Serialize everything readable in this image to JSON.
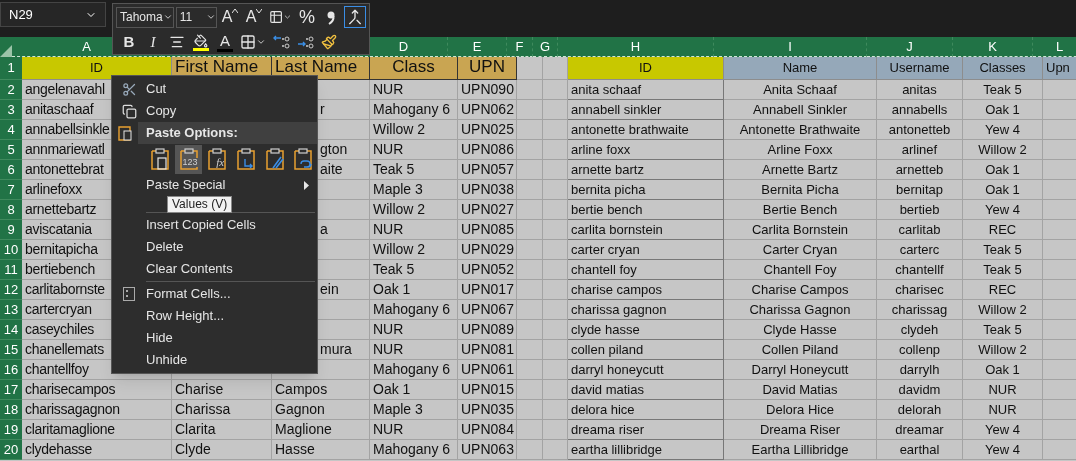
{
  "name_box": {
    "value": "N29"
  },
  "mini_toolbar": {
    "font_name": "Tahoma",
    "font_size": "11",
    "row_1": [
      {
        "kind": "grow-font",
        "glyph": "A"
      },
      {
        "kind": "shrink-font",
        "glyph": "A"
      },
      {
        "kind": "cell-styles"
      },
      {
        "kind": "percent",
        "glyph": "%"
      },
      {
        "kind": "comma"
      },
      {
        "kind": "merge"
      }
    ],
    "row_2": [
      {
        "kind": "bold",
        "glyph": "B"
      },
      {
        "kind": "italic",
        "glyph": "I"
      },
      {
        "kind": "center"
      },
      {
        "kind": "fill-color",
        "color": "#ffff00"
      },
      {
        "kind": "font-color",
        "glyph": "A",
        "color": "#000000"
      },
      {
        "kind": "borders"
      },
      {
        "kind": "inc-decimal"
      },
      {
        "kind": "dec-decimal"
      },
      {
        "kind": "painter"
      }
    ]
  },
  "columns": {
    "a": "A",
    "d": "D",
    "e": "E",
    "f": "F",
    "g": "G",
    "h": "H",
    "i": "I",
    "j": "J",
    "k": "K",
    "l": "L"
  },
  "header_row": {
    "number": "1",
    "cells": {
      "a": {
        "text": "ID",
        "color": "#c8c800"
      },
      "b": {
        "text": "First Name",
        "color": "#c9a552"
      },
      "c": {
        "text": "Last Name",
        "color": "#c9a552"
      },
      "d": {
        "text": "Class",
        "color": "#c9a552"
      },
      "e": {
        "text": "UPN",
        "color": "#c9a552"
      },
      "h": {
        "text": "ID",
        "color": "#c8c800"
      },
      "i": {
        "text": "Name",
        "color": "#95a8b9"
      },
      "j": {
        "text": "Username",
        "color": "#95a8b9"
      },
      "k": {
        "text": "Classes",
        "color": "#95a8b9"
      },
      "l": {
        "text": "Upn",
        "color": "#95a8b9"
      }
    }
  },
  "rows": [
    {
      "number": "2",
      "cells": {
        "a": "angelenavahl",
        "d": "NUR",
        "e": "UPN090",
        "h": "anita schaaf",
        "i": "Anita Schaaf",
        "j": "anitas",
        "k": "Teak 5"
      }
    },
    {
      "number": "3",
      "cells": {
        "a": "anitaschaaf",
        "c": "r",
        "d": "Mahogany 6",
        "e": "UPN062",
        "h": "annabell sinkler",
        "i": "Annabell Sinkler",
        "j": "annabells",
        "k": "Oak 1"
      }
    },
    {
      "number": "4",
      "cells": {
        "a": "annabellsinkle",
        "d": "Willow 2",
        "e": "UPN025",
        "h": "antonette brathwaite",
        "i": "Antonette Brathwaite",
        "j": "antonetteb",
        "k": "Yew 4"
      }
    },
    {
      "number": "5",
      "cells": {
        "a": "annmariewatl",
        "c": "gton",
        "d": "NUR",
        "e": "UPN086",
        "h": "arline foxx",
        "i": "Arline Foxx",
        "j": "arlinef",
        "k": "Willow 2"
      }
    },
    {
      "number": "6",
      "cells": {
        "a": "antonettebrat",
        "c": "aite",
        "d": "Teak 5",
        "e": "UPN057",
        "h": "arnette bartz",
        "i": "Arnette Bartz",
        "j": "arnetteb",
        "k": "Oak 1"
      }
    },
    {
      "number": "7",
      "cells": {
        "a": "arlinefoxx",
        "d": "Maple 3",
        "e": "UPN038",
        "h": "bernita picha",
        "i": "Bernita Picha",
        "j": "bernitap",
        "k": "Oak 1"
      }
    },
    {
      "number": "8",
      "cells": {
        "a": "arnettebartz",
        "d": "Willow 2",
        "e": "UPN027",
        "h": "bertie bench",
        "i": "Bertie Bench",
        "j": "bertieb",
        "k": "Yew 4"
      }
    },
    {
      "number": "9",
      "cells": {
        "a": "aviscatania",
        "c": "a",
        "d": "NUR",
        "e": "UPN085",
        "h": "carlita bornstein",
        "i": "Carlita Bornstein",
        "j": "carlitab",
        "k": "REC"
      }
    },
    {
      "number": "10",
      "cells": {
        "a": "bernitapicha",
        "d": "Willow 2",
        "e": "UPN029",
        "h": "carter cryan",
        "i": "Carter Cryan",
        "j": "carterc",
        "k": "Teak 5"
      }
    },
    {
      "number": "11",
      "cells": {
        "a": "bertiebench",
        "d": "Teak 5",
        "e": "UPN052",
        "h": "chantell foy",
        "i": "Chantell Foy",
        "j": "chantellf",
        "k": "Teak 5"
      }
    },
    {
      "number": "12",
      "cells": {
        "a": "carlitabornste",
        "c": "ein",
        "d": "Oak 1",
        "e": "UPN017",
        "h": "charise campos",
        "i": "Charise Campos",
        "j": "charisec",
        "k": "REC"
      }
    },
    {
      "number": "13",
      "cells": {
        "a": "cartercryan",
        "d": "Mahogany 6",
        "e": "UPN067",
        "h": "charissa gagnon",
        "i": "Charissa Gagnon",
        "j": "charissag",
        "k": "Willow 2"
      }
    },
    {
      "number": "14",
      "cells": {
        "a": "caseychiles",
        "d": "NUR",
        "e": "UPN089",
        "h": "clyde hasse",
        "i": "Clyde Hasse",
        "j": "clydeh",
        "k": "Teak 5"
      }
    },
    {
      "number": "15",
      "cells": {
        "a": "chanellemats",
        "c": "mura",
        "d": "NUR",
        "e": "UPN081",
        "h": "collen piland",
        "i": "Collen Piland",
        "j": "collenp",
        "k": "Willow 2"
      }
    },
    {
      "number": "16",
      "cells": {
        "a": "chantellfoy",
        "d": "Mahogany 6",
        "e": "UPN061",
        "h": "darryl honeycutt",
        "i": "Darryl Honeycutt",
        "j": "darrylh",
        "k": "Oak 1"
      }
    },
    {
      "number": "17",
      "cells": {
        "a": "charisecampos",
        "b": "Charise",
        "c": "Campos",
        "d": "Oak 1",
        "e": "UPN015",
        "h": "david matias",
        "i": "David Matias",
        "j": "davidm",
        "k": "NUR"
      }
    },
    {
      "number": "18",
      "cells": {
        "a": "charissagagnon",
        "b": "Charissa",
        "c": "Gagnon",
        "d": "Maple 3",
        "e": "UPN035",
        "h": "delora hice",
        "i": "Delora Hice",
        "j": "delorah",
        "k": "NUR"
      }
    },
    {
      "number": "19",
      "cells": {
        "a": "claritamaglione",
        "b": "Clarita",
        "c": "Maglione",
        "d": "NUR",
        "e": "UPN084",
        "h": "dreama riser",
        "i": "Dreama Riser",
        "j": "dreamar",
        "k": "Yew 4"
      }
    },
    {
      "number": "20",
      "cells": {
        "a": "clydehasse",
        "b": "Clyde",
        "c": "Hasse",
        "d": "Mahogany 6",
        "e": "UPN063",
        "h": "eartha lillibridge",
        "i": "Eartha Lillibridge",
        "j": "earthal",
        "k": "Yew 4"
      }
    }
  ],
  "context_menu": {
    "items": [
      {
        "kind": "cut",
        "label": "Cut"
      },
      {
        "kind": "copy",
        "label": "Copy"
      },
      {
        "kind": "paste-header",
        "label": "Paste Options:"
      },
      {
        "kind": "paste-icons",
        "options": [
          {
            "kind": "paste",
            "selected": false
          },
          {
            "kind": "values",
            "glyph": "123",
            "selected": true
          },
          {
            "kind": "formulas",
            "glyph": "fx",
            "selected": false
          },
          {
            "kind": "transpose",
            "selected": false
          },
          {
            "kind": "formatting",
            "selected": false
          },
          {
            "kind": "link",
            "selected": false
          }
        ]
      },
      {
        "kind": "submenu",
        "label": "Paste Special"
      },
      {
        "kind": "separator"
      },
      {
        "kind": "plain",
        "label": "Insert Copied Cells"
      },
      {
        "kind": "plain",
        "label": "Delete"
      },
      {
        "kind": "plain",
        "label": "Clear Contents"
      },
      {
        "kind": "separator"
      },
      {
        "kind": "format",
        "label": "Format Cells..."
      },
      {
        "kind": "plain",
        "label": "Row Height..."
      },
      {
        "kind": "plain",
        "label": "Hide"
      },
      {
        "kind": "plain",
        "label": "Unhide"
      }
    ]
  },
  "tooltip": {
    "text": "Values (V)"
  }
}
